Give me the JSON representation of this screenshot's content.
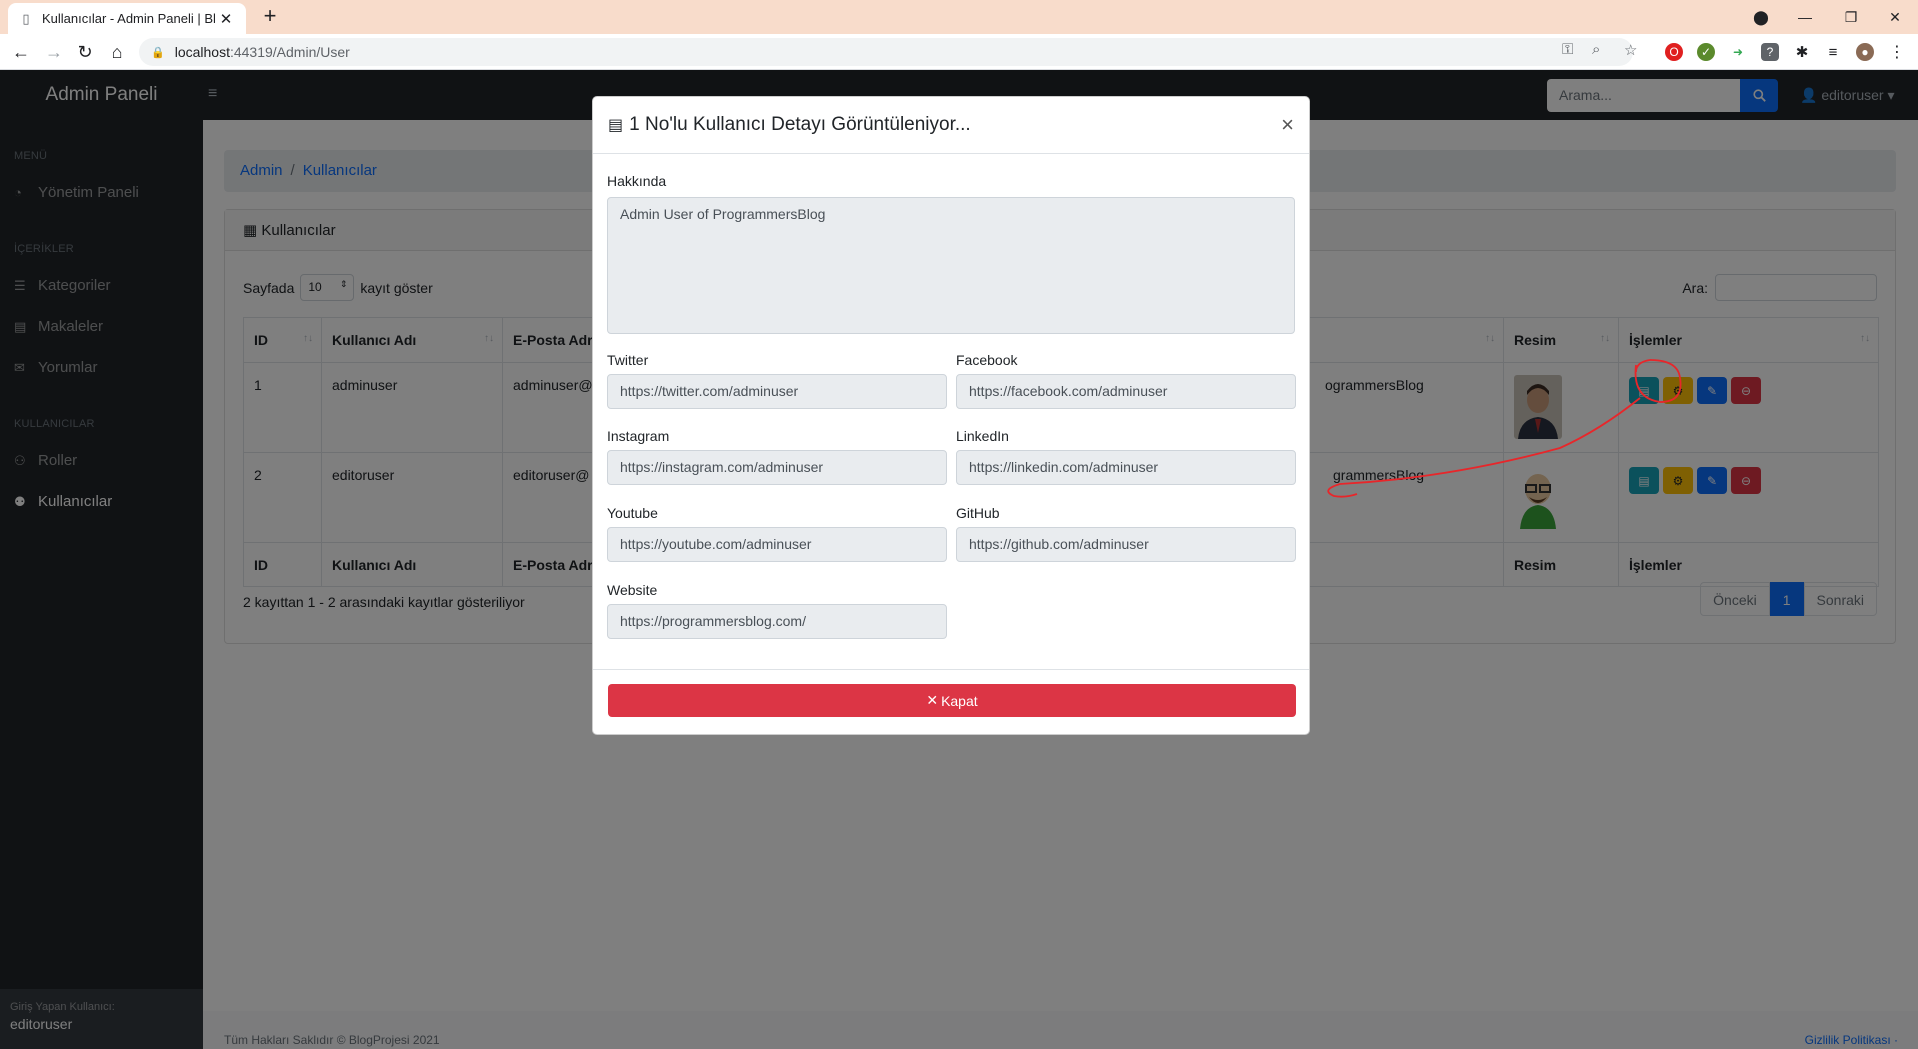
{
  "browser": {
    "tab_title": "Kullanıcılar - Admin Paneli | Blog",
    "url_host": "localhost",
    "url_rest": ":44319/Admin/User"
  },
  "header": {
    "brand": "Admin Paneli",
    "search_placeholder": "Arama...",
    "user": "editoruser"
  },
  "sidebar": {
    "sections": [
      {
        "title": "MENÜ"
      },
      {
        "title": "İÇERİKLER"
      },
      {
        "title": "KULLANICILAR"
      }
    ],
    "items": [
      {
        "label": "Yönetim Paneli",
        "icon": "dashboard-icon"
      },
      {
        "label": "Kategoriler",
        "icon": "list-icon"
      },
      {
        "label": "Makaleler",
        "icon": "file-icon"
      },
      {
        "label": "Yorumlar",
        "icon": "comments-icon"
      },
      {
        "label": "Roller",
        "icon": "user-tag-icon"
      },
      {
        "label": "Kullanıcılar",
        "icon": "users-icon"
      }
    ],
    "footer_small": "Giriş Yapan Kullanıcı:",
    "footer_name": "editoruser"
  },
  "breadcrumb": {
    "root": "Admin",
    "current": "Kullanıcılar"
  },
  "card": {
    "title": "Kullanıcılar",
    "page_len_prefix": "Sayfada",
    "page_len_value": "10",
    "page_len_suffix": "kayıt göster",
    "search_label": "Ara:"
  },
  "table": {
    "columns": [
      "ID",
      "Kullanıcı Adı",
      "E-Posta Adr",
      "",
      "Resim",
      "İşlemler"
    ],
    "rows": [
      {
        "id": "1",
        "username": "adminuser",
        "email": "adminuser@",
        "about": "ogrammersBlog"
      },
      {
        "id": "2",
        "username": "editoruser",
        "email": "editoruser@",
        "about": "grammersBlog"
      }
    ],
    "info": "2 kayıttan 1 - 2 arasındaki kayıtlar gösteriliyor",
    "pager": {
      "prev": "Önceki",
      "page": "1",
      "next": "Sonraki"
    }
  },
  "footer": {
    "copyright": "Tüm Hakları Saklıdır © BlogProjesi 2021",
    "privacy": "Gizlilik Politikası ·"
  },
  "modal": {
    "title": "1 No'lu Kullanıcı Detayı Görüntüleniyor...",
    "about_label": "Hakkında",
    "about_value": "Admin User of ProgrammersBlog",
    "fields": {
      "twitter_label": "Twitter",
      "twitter": "https://twitter.com/adminuser",
      "facebook_label": "Facebook",
      "facebook": "https://facebook.com/adminuser",
      "instagram_label": "Instagram",
      "instagram": "https://instagram.com/adminuser",
      "linkedin_label": "LinkedIn",
      "linkedin": "https://linkedin.com/adminuser",
      "youtube_label": "Youtube",
      "youtube": "https://youtube.com/adminuser",
      "github_label": "GitHub",
      "github": "https://github.com/adminuser",
      "website_label": "Website",
      "website": "https://programmersblog.com/"
    },
    "close_label": "Kapat"
  },
  "colors": {
    "primary": "#0d6efd",
    "danger": "#dc3545",
    "info": "#17a2b8",
    "warning": "#ffc107",
    "dark": "#212529",
    "annotation": "#e8262a"
  }
}
